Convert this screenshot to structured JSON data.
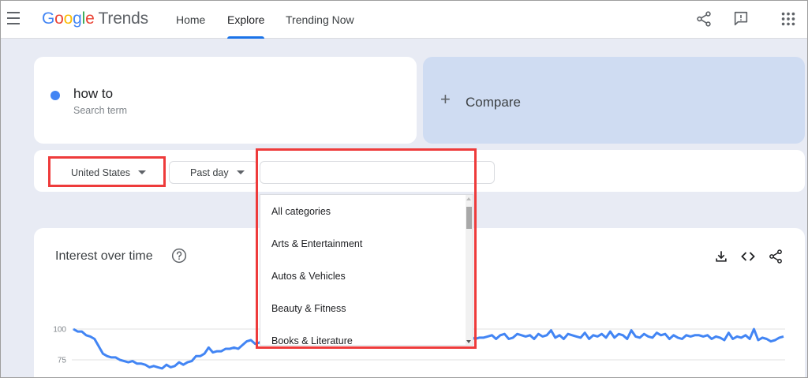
{
  "header": {
    "logo_google": [
      "G",
      "o",
      "o",
      "g",
      "l",
      "e"
    ],
    "logo_product": "Trends",
    "nav": [
      {
        "label": "Home",
        "active": false
      },
      {
        "label": "Explore",
        "active": true
      },
      {
        "label": "Trending Now",
        "active": false
      }
    ],
    "icons": [
      "menu-icon",
      "share-icon",
      "feedback-icon",
      "apps-grid-icon"
    ]
  },
  "search": {
    "term": "how to",
    "term_caption": "Search term",
    "term_color": "#4285f4",
    "compare_label": "Compare"
  },
  "filters": {
    "region": "United States",
    "time_range": "Past day",
    "category_value": ""
  },
  "category_dropdown": {
    "options": [
      "All categories",
      "Arts & Entertainment",
      "Autos & Vehicles",
      "Beauty & Fitness",
      "Books & Literature"
    ]
  },
  "chart": {
    "title": "Interest over time",
    "actions": [
      "download-icon",
      "embed-code-icon",
      "share-icon"
    ]
  },
  "chart_data": {
    "type": "line",
    "title": "Interest over time",
    "ylim": [
      50,
      100
    ],
    "yticks": [
      100,
      75
    ],
    "series": [
      {
        "color": "#4285f4",
        "values": [
          100,
          98,
          98,
          95,
          94,
          92,
          86,
          80,
          78,
          77,
          77,
          75,
          74,
          73,
          74,
          72,
          72,
          71,
          69,
          70,
          69,
          68,
          71,
          69,
          70,
          73,
          71,
          73,
          74,
          78,
          78,
          80,
          85,
          81,
          82,
          82,
          84,
          84,
          85,
          84,
          87,
          90,
          91,
          88,
          89,
          92,
          95,
          93,
          95,
          96,
          92,
          94,
          94,
          93,
          95,
          92,
          96,
          95,
          94,
          97,
          98,
          92,
          96,
          96,
          95,
          91,
          95,
          96,
          98,
          94,
          91,
          95,
          96,
          95,
          92,
          93,
          94,
          95,
          92,
          93,
          96,
          94,
          94,
          93,
          95,
          91,
          95,
          93,
          94,
          92,
          93,
          91,
          95,
          93,
          94,
          92,
          93,
          93,
          94,
          95,
          92,
          95,
          96,
          92,
          93,
          96,
          95,
          94,
          95,
          92,
          96,
          94,
          95,
          99,
          93,
          95,
          92,
          96,
          95,
          94,
          93,
          97,
          92,
          95,
          94,
          96,
          93,
          98,
          93,
          96,
          95,
          92,
          99,
          94,
          93,
          96,
          94,
          93,
          97,
          95,
          96,
          92,
          95,
          93,
          92,
          95,
          94,
          95,
          95,
          94,
          95,
          92,
          94,
          93,
          91,
          97,
          92,
          94,
          93,
          95,
          92,
          100,
          91,
          93,
          92,
          90,
          91,
          93,
          94
        ]
      }
    ]
  }
}
